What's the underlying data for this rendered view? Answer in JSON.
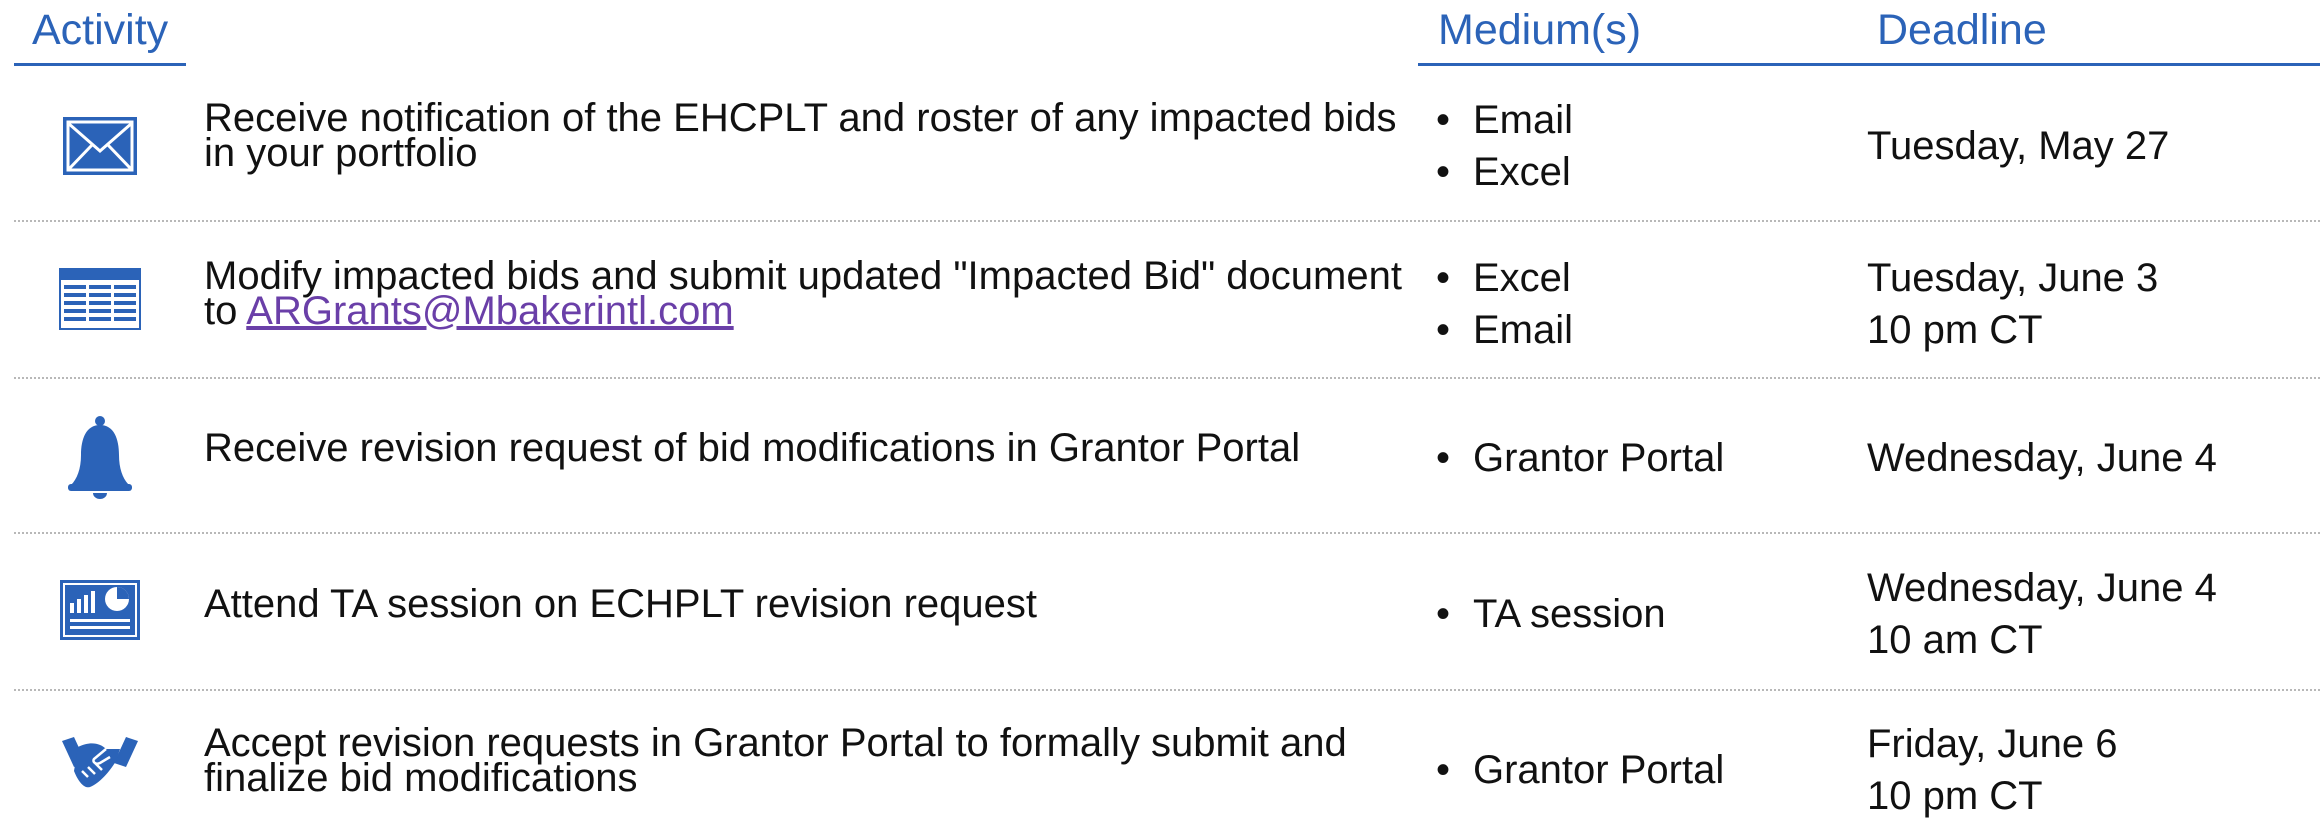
{
  "header": {
    "activity": "Activity",
    "medium": "Medium(s)",
    "deadline": "Deadline"
  },
  "rows": [
    {
      "icon": "envelope-icon",
      "activity": "Receive notification of the EHCPLT and roster of any impacted bids in your portfolio",
      "mediums": [
        "Email",
        "Excel"
      ],
      "deadline": [
        "Tuesday, May 27"
      ]
    },
    {
      "icon": "spreadsheet-icon",
      "activity_prefix": "Modify impacted bids and submit updated \"Impacted Bid\" document to ",
      "activity_link": "ARGrants@Mbakerintl.com",
      "mediums": [
        "Excel",
        "Email"
      ],
      "deadline": [
        "Tuesday, June 3",
        "10 pm CT"
      ]
    },
    {
      "icon": "bell-icon",
      "activity": "Receive revision request of bid modifications in Grantor Portal",
      "mediums": [
        "Grantor Portal"
      ],
      "deadline": [
        "Wednesday, June 4"
      ]
    },
    {
      "icon": "presentation-chart-icon",
      "activity": "Attend TA session on ECHPLT revision request",
      "mediums": [
        "TA session"
      ],
      "deadline": [
        "Wednesday, June 4",
        "10 am CT"
      ]
    },
    {
      "icon": "handshake-icon",
      "activity": "Accept revision requests in Grantor Portal to formally submit and finalize bid modifications",
      "mediums": [
        "Grantor Portal"
      ],
      "deadline": [
        "Friday, June 6",
        "10 pm CT"
      ]
    }
  ],
  "colors": {
    "accent": "#2b63b8",
    "link": "#6a3fa8",
    "divider": "#b8b8b8",
    "icon_fill": "#2b63b8"
  }
}
